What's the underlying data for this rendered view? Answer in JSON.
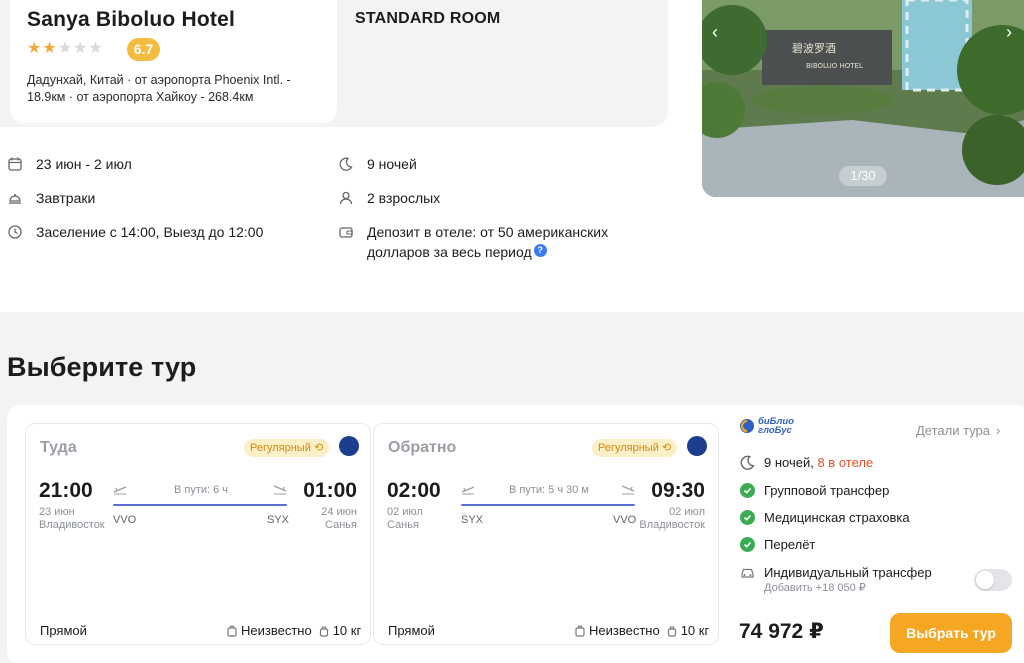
{
  "hotel": {
    "name": "Sanya Biboluo Hotel",
    "stars": 2,
    "max_stars": 5,
    "rating": "6.7",
    "location": "Дадунхай, Китай · от аэропорта Phoenix Intl. - 18.9км · от аэропорта Хайкоу - 268.4км",
    "room": "STANDARD ROOM",
    "photo_counter": "1/30"
  },
  "details": {
    "dates": "23 июн - 2 июл",
    "nights": "9 ночей",
    "meals": "Завтраки",
    "guests": "2 взрослых",
    "checkin": "Заселение с 14:00, Выезд до 12:00",
    "deposit": "Депозит в отеле: от 50 американских долларов за весь период",
    "deposit_help": "?"
  },
  "tour": {
    "section_title": "Выберите тур",
    "outbound": {
      "title": "Туда",
      "badge": "Регулярный",
      "dep_time": "21:00",
      "dep_date": "23 июн",
      "dep_city": "Владивосток",
      "dep_code": "VVO",
      "duration": "В пути: 6 ч",
      "arr_code": "SYX",
      "arr_time": "01:00",
      "arr_date": "24 июн",
      "arr_city": "Санья",
      "type": "Прямой",
      "baggage": "Неизвестно",
      "hand_luggage": "10 кг"
    },
    "return": {
      "title": "Обратно",
      "badge": "Регулярный",
      "dep_time": "02:00",
      "dep_date": "02 июл",
      "dep_city": "Санья",
      "dep_code": "SYX",
      "duration": "В пути: 5 ч 30 м",
      "arr_code": "VVO",
      "arr_time": "09:30",
      "arr_date": "02 июл",
      "arr_city": "Владивосток",
      "type": "Прямой",
      "baggage": "Неизвестно",
      "hand_luggage": "10 кг"
    },
    "operator": {
      "logo_line1": "биБлио",
      "logo_line2": "глоБус",
      "details_link": "Детали тура",
      "nights": "9 ночей,",
      "nights_hotel": "8 в отеле",
      "features": [
        "Групповой трансфер",
        "Медицинская страховка",
        "Перелёт"
      ],
      "addon": "Индивидуальный трансфер",
      "addon_price": "Добавить +18 050 ₽",
      "price": "74 972 ₽",
      "select_label": "Выбрать тур"
    }
  },
  "colors": {
    "accent": "#f5a623",
    "rating": "#f4bc3e",
    "check": "#3aaa55",
    "route": "#5a6fd6",
    "red": "#e0502a"
  }
}
